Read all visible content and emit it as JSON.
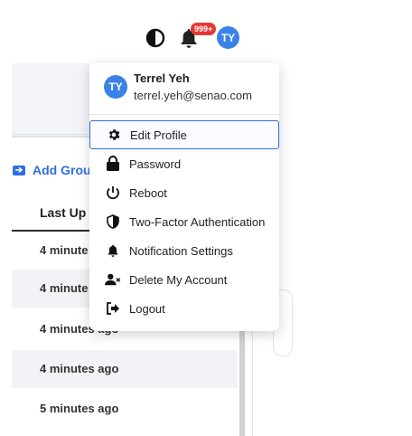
{
  "topbar": {
    "notification_badge": "999+",
    "avatar_initials": "TY",
    "icons": [
      "contrast-icon",
      "bell-icon"
    ]
  },
  "user": {
    "initials": "TY",
    "name": "Terrel Yeh",
    "email": "terrel.yeh@senao.com"
  },
  "menu": {
    "items": [
      {
        "label": "Edit Profile",
        "icon": "gear-icon"
      },
      {
        "label": "Password",
        "icon": "lock-icon"
      },
      {
        "label": "Reboot",
        "icon": "power-icon"
      },
      {
        "label": "Two-Factor Authentication",
        "icon": "shield-icon"
      },
      {
        "label": "Notification Settings",
        "icon": "bell-icon"
      },
      {
        "label": "Delete My Account",
        "icon": "user-delete-icon"
      },
      {
        "label": "Logout",
        "icon": "logout-icon"
      }
    ]
  },
  "background": {
    "add_group_label": "Add Grou",
    "column_header": "Last Up",
    "rows": [
      "4 minute",
      "4 minute",
      "4 minutes ago",
      "4 minutes ago",
      "5 minutes ago"
    ]
  },
  "colors": {
    "accent": "#2f6ee0",
    "avatar": "#3b82e6",
    "badge": "#e53935"
  }
}
